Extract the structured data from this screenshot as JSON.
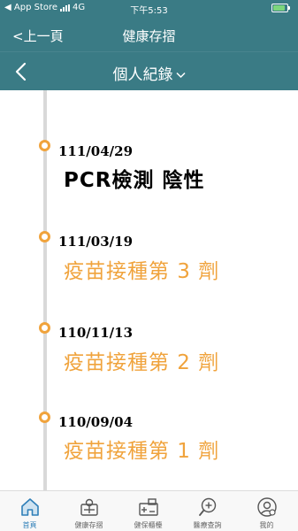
{
  "status_bar": {
    "carrier": "App Store",
    "network": "4G",
    "time": "下午5:53",
    "battery_level": 0.85
  },
  "top_nav": {
    "back_label": "<上一頁",
    "title": "健康存摺"
  },
  "sub_header": {
    "title": "個人紀錄"
  },
  "timeline": [
    {
      "date": "111/04/29",
      "event": "PCR檢測 陰性",
      "kind": "result"
    },
    {
      "date": "111/03/19",
      "event": "疫苗接種第 3 劑",
      "kind": "vaccine"
    },
    {
      "date": "110/11/13",
      "event": "疫苗接種第 2 劑",
      "kind": "vaccine"
    },
    {
      "date": "110/09/04",
      "event": "疫苗接種第 1 劑",
      "kind": "vaccine"
    }
  ],
  "tabs": [
    {
      "label": "首頁",
      "icon": "home-icon",
      "active": true
    },
    {
      "label": "健康存摺",
      "icon": "health-passbook-icon",
      "active": false
    },
    {
      "label": "健保櫃檯",
      "icon": "insurance-counter-icon",
      "active": false
    },
    {
      "label": "醫療查詢",
      "icon": "medical-search-icon",
      "active": false
    },
    {
      "label": "我的",
      "icon": "profile-icon",
      "active": false
    }
  ],
  "colors": {
    "header": "#3a7b85",
    "accent": "#f0a33c",
    "tab_active": "#2f7fb8"
  }
}
